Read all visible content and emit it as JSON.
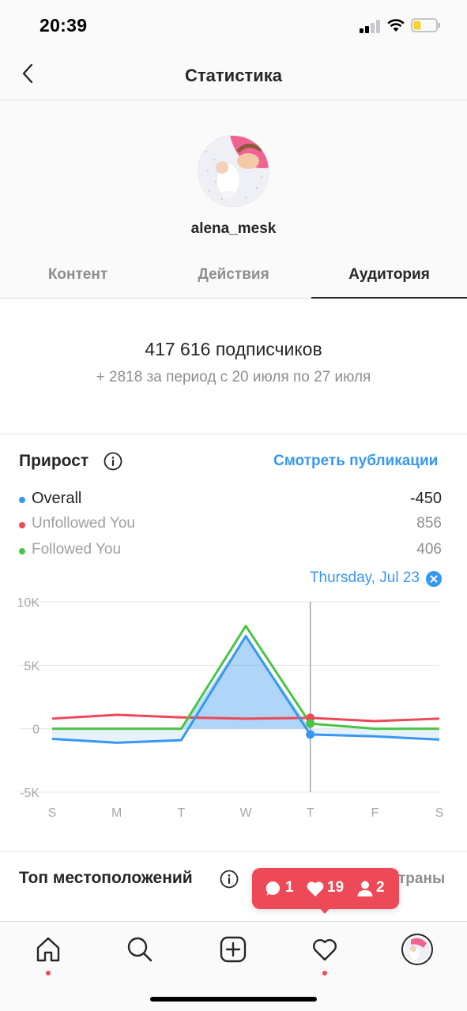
{
  "status_bar": {
    "time": "20:39"
  },
  "header": {
    "title": "Статистика"
  },
  "profile": {
    "username": "alena_mesk"
  },
  "tabs": [
    {
      "label": "Контент",
      "active": false
    },
    {
      "label": "Действия",
      "active": false
    },
    {
      "label": "Аудитория",
      "active": true
    }
  ],
  "followers": {
    "count_text": "417 616 подписчиков",
    "period_text": "+ 2818 за период с 20 июля по 27 июля"
  },
  "growth": {
    "title": "Прирост",
    "view_posts_link": "Смотреть публикации",
    "legend": [
      {
        "label": "Overall",
        "value": "-450",
        "color": "#3897f0"
      },
      {
        "label": "Unfollowed You",
        "value": "856",
        "color": "#ed4956"
      },
      {
        "label": "Followed You",
        "value": "406",
        "color": "#4bc445"
      }
    ],
    "selected_day": "Thursday, Jul 23"
  },
  "chart_data": {
    "type": "line",
    "x": [
      "S",
      "M",
      "T",
      "W",
      "T",
      "F",
      "S"
    ],
    "y_ticks": [
      "10K",
      "5K",
      "0",
      "-5K"
    ],
    "ylim": [
      -5000,
      10000
    ],
    "grid": true,
    "selected_index": 4,
    "series": [
      {
        "name": "Overall",
        "color": "#3897f0",
        "values": [
          -800,
          -1100,
          -900,
          7300,
          -450,
          -600,
          -850
        ]
      },
      {
        "name": "Unfollowed You",
        "color": "#ed4956",
        "values": [
          800,
          1100,
          900,
          800,
          856,
          600,
          800
        ]
      },
      {
        "name": "Followed You",
        "color": "#4bc445",
        "values": [
          0,
          0,
          0,
          8100,
          406,
          0,
          0
        ]
      }
    ]
  },
  "top_locations": {
    "title": "Топ местоположений",
    "countries_label": "траны"
  },
  "activity_toast": {
    "comments": "1",
    "likes": "19",
    "follows": "2"
  }
}
